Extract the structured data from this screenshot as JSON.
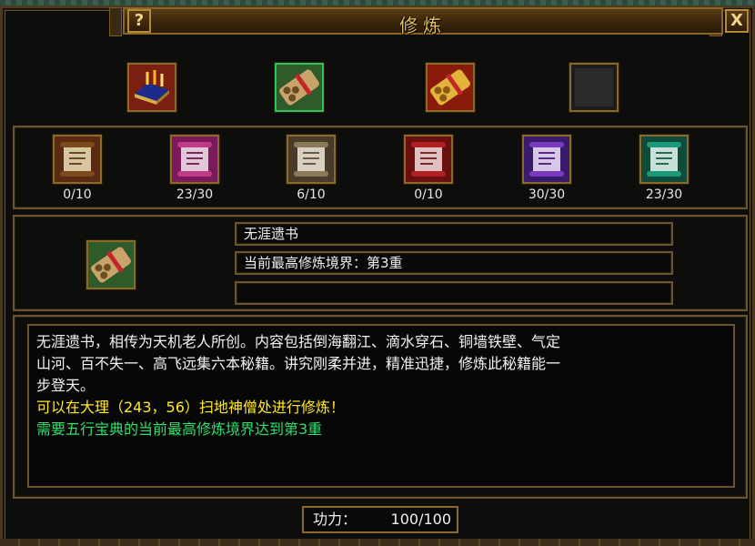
{
  "window": {
    "title": "修炼",
    "help_label": "?",
    "close_label": "X"
  },
  "top_icons": [
    {
      "icon": "gold-book-icon"
    },
    {
      "icon": "green-scroll-bundle-icon"
    },
    {
      "icon": "golden-scroll-bundle-icon"
    },
    {
      "icon": "empty-slot-icon"
    }
  ],
  "scrolls": [
    {
      "icon": "brown-scroll-icon",
      "count": "0/10"
    },
    {
      "icon": "pink-scroll-icon",
      "count": "23/30"
    },
    {
      "icon": "grey-scroll-icon",
      "count": "6/10"
    },
    {
      "icon": "red-scroll-icon",
      "count": "0/10"
    },
    {
      "icon": "purple-scroll-icon",
      "count": "30/30"
    },
    {
      "icon": "teal-scroll-icon",
      "count": "23/30"
    }
  ],
  "selected": {
    "icon": "green-scroll-bundle-icon",
    "name": "无涯遗书",
    "realm": "当前最高修炼境界：第3重",
    "extra": ""
  },
  "description": {
    "line1": "无涯遗书，相传为天机老人所创。内容包括倒海翻江、滴水穿石、铜墙铁壁、气定",
    "line2": "山河、百不失一、高飞远集六本秘籍。讲究刚柔并进，精准迅捷，修炼此秘籍能一",
    "line3": "步登天。",
    "location_hint": "可以在大理（243，56）扫地神僧处进行修炼！",
    "requirement": "需要五行宝典的当前最高修炼境界达到第3重"
  },
  "power": {
    "label": "功力：",
    "value": "100/100"
  },
  "colors": {
    "frame_gold": "#8a6a2a",
    "title_gold": "#e3c162",
    "hint_yellow": "#ffe82a",
    "requirement_green": "#2ee06a"
  }
}
